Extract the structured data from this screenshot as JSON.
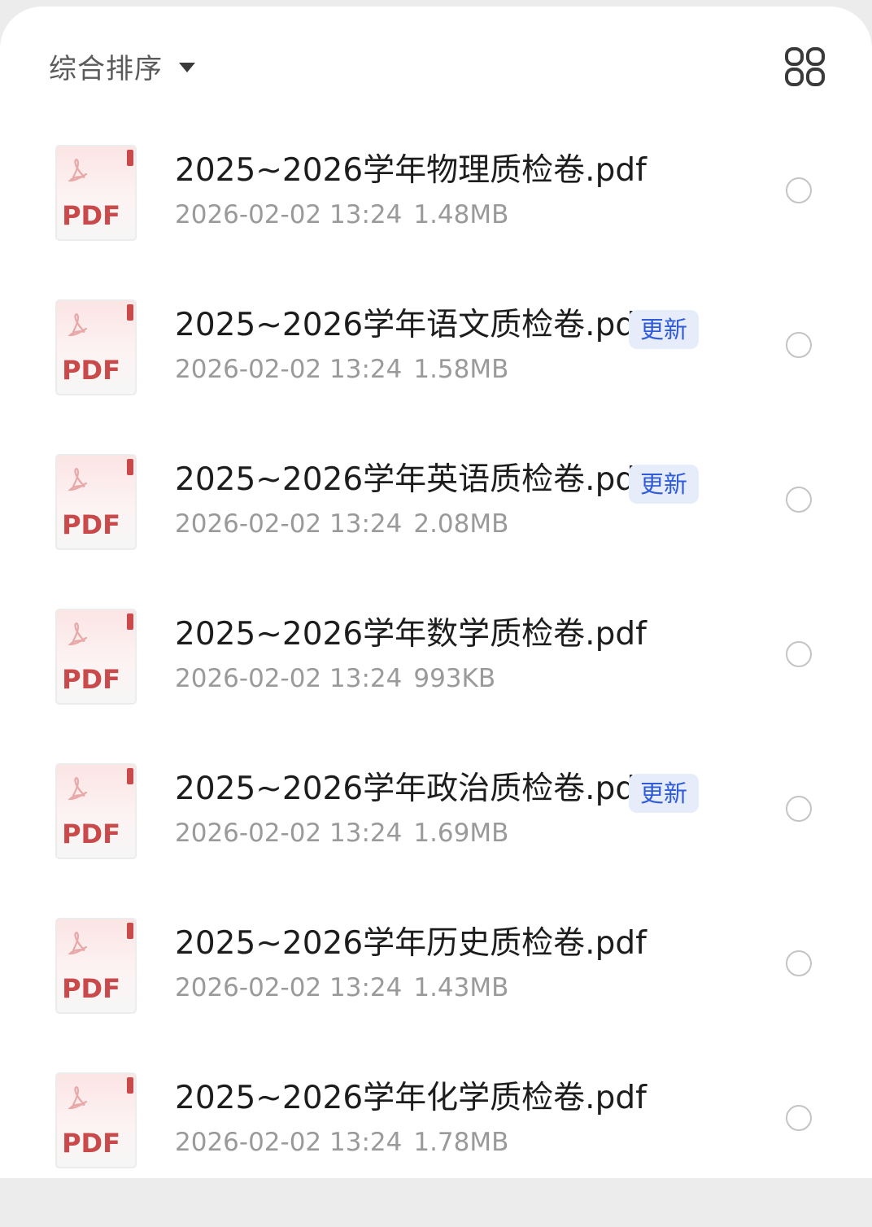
{
  "toolbar": {
    "sort_label": "综合排序",
    "sort_caret_icon": "caret-down-icon",
    "view_toggle_icon": "grid-view-icon"
  },
  "file_icon": {
    "label": "PDF",
    "icon_name": "pdf-file-icon"
  },
  "files": [
    {
      "name": "2025~2026学年物理质检卷.pdf",
      "date": "2026-02-02 13:24",
      "size": "1.48MB",
      "badge": ""
    },
    {
      "name": "2025~2026学年语文质检卷.pdf",
      "date": "2026-02-02 13:24",
      "size": "1.58MB",
      "badge": "更新"
    },
    {
      "name": "2025~2026学年英语质检卷.pdf",
      "date": "2026-02-02 13:24",
      "size": "2.08MB",
      "badge": "更新"
    },
    {
      "name": "2025~2026学年数学质检卷.pdf",
      "date": "2026-02-02 13:24",
      "size": "993KB",
      "badge": ""
    },
    {
      "name": "2025~2026学年政治质检卷.pdf",
      "date": "2026-02-02 13:24",
      "size": "1.69MB",
      "badge": "更新"
    },
    {
      "name": "2025~2026学年历史质检卷.pdf",
      "date": "2026-02-02 13:24",
      "size": "1.43MB",
      "badge": ""
    },
    {
      "name": "2025~2026学年化学质检卷.pdf",
      "date": "2026-02-02 13:24",
      "size": "1.78MB",
      "badge": ""
    }
  ],
  "colors": {
    "badge_bg": "#e7ecfb",
    "badge_text": "#2f5bd8",
    "pdf_red": "#c94a4a"
  }
}
